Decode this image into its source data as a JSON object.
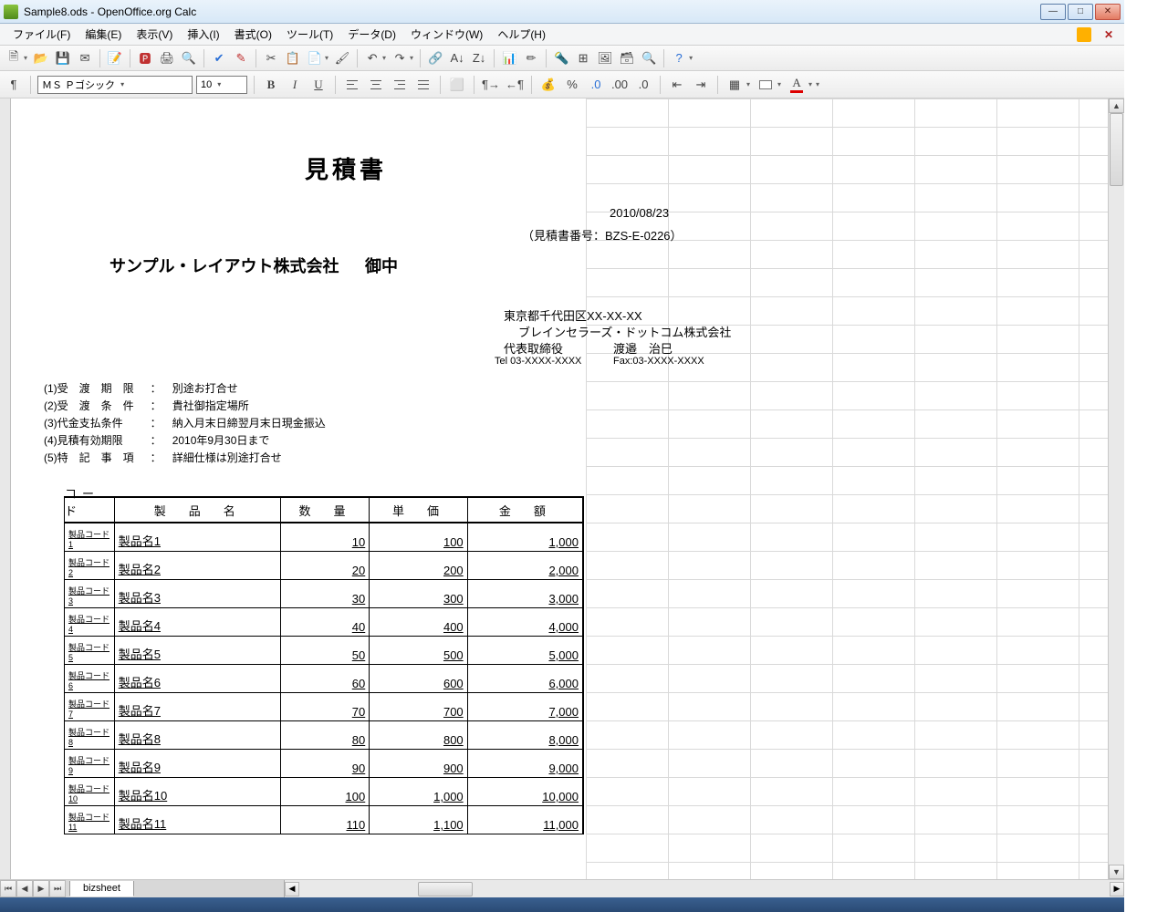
{
  "window": {
    "title": "Sample8.ods - OpenOffice.org Calc"
  },
  "menus": {
    "file": "ファイル(F)",
    "edit": "編集(E)",
    "view": "表示(V)",
    "insert": "挿入(I)",
    "format": "書式(O)",
    "tools": "ツール(T)",
    "data": "データ(D)",
    "window": "ウィンドウ(W)",
    "help": "ヘルプ(H)"
  },
  "font": {
    "name": "ＭＳ Ｐゴシック",
    "size": "10"
  },
  "tabs": {
    "sheet1": "bizsheet"
  },
  "doc": {
    "title": "見積書",
    "date": "2010/08/23",
    "quote_no": "（見積書番号：BZS-E-0226）",
    "customer": "サンプル・レイアウト株式会社",
    "onchu": "御中",
    "addr": "東京都千代田区XX-XX-XX",
    "company": "ブレインセラーズ・ドットコム株式会社",
    "rep_title": "代表取締役",
    "rep_name": "渡邉　治巳",
    "tel": "Tel 03-XXXX-XXXX",
    "fax": "Fax:03-XXXX-XXXX"
  },
  "terms": [
    {
      "label": "(1)受　渡　期　限",
      "value": "別途お打合せ"
    },
    {
      "label": "(2)受　渡　条　件",
      "value": "貴社御指定場所"
    },
    {
      "label": "(3)代金支払条件",
      "value": "納入月末日締翌月末日現金振込"
    },
    {
      "label": "(4)見積有効期限",
      "value": "2010年9月30日まで"
    },
    {
      "label": "(5)特　記　事　項",
      "value": "詳細仕様は別途打合せ"
    }
  ],
  "table": {
    "headers": {
      "code": "コード",
      "name": "製　品　名",
      "qty": "数　量",
      "price": "単　価",
      "amount": "金　額"
    },
    "rows": [
      {
        "code": "製品コード1",
        "name": "製品名1",
        "qty": "10",
        "price": "100",
        "amount": "1,000"
      },
      {
        "code": "製品コード2",
        "name": "製品名2",
        "qty": "20",
        "price": "200",
        "amount": "2,000"
      },
      {
        "code": "製品コード3",
        "name": "製品名3",
        "qty": "30",
        "price": "300",
        "amount": "3,000"
      },
      {
        "code": "製品コード4",
        "name": "製品名4",
        "qty": "40",
        "price": "400",
        "amount": "4,000"
      },
      {
        "code": "製品コード5",
        "name": "製品名5",
        "qty": "50",
        "price": "500",
        "amount": "5,000"
      },
      {
        "code": "製品コード6",
        "name": "製品名6",
        "qty": "60",
        "price": "600",
        "amount": "6,000"
      },
      {
        "code": "製品コード7",
        "name": "製品名7",
        "qty": "70",
        "price": "700",
        "amount": "7,000"
      },
      {
        "code": "製品コード8",
        "name": "製品名8",
        "qty": "80",
        "price": "800",
        "amount": "8,000"
      },
      {
        "code": "製品コード9",
        "name": "製品名9",
        "qty": "90",
        "price": "900",
        "amount": "9,000"
      },
      {
        "code": "製品コード10",
        "name": "製品名10",
        "qty": "100",
        "price": "1,000",
        "amount": "10,000"
      },
      {
        "code": "製品コード11",
        "name": "製品名11",
        "qty": "110",
        "price": "1,100",
        "amount": "11,000"
      }
    ]
  }
}
